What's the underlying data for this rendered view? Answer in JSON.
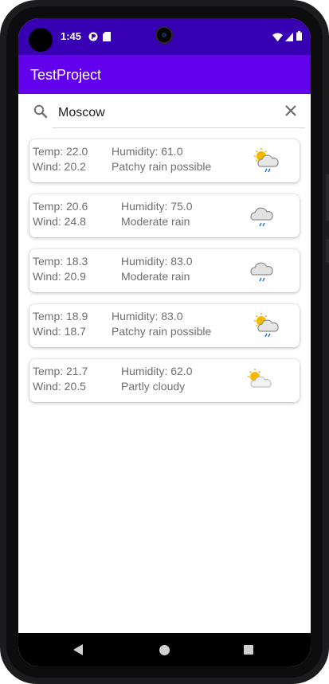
{
  "status_bar": {
    "time": "1:45",
    "icons": [
      "notification-icon",
      "sd-card-icon",
      "wifi-icon",
      "cellular-signal-icon",
      "battery-icon"
    ],
    "color": "#3700b3"
  },
  "app_bar": {
    "title": "TestProject",
    "color": "#6200ee"
  },
  "search": {
    "value": "Moscow",
    "icon": "search-icon",
    "clear_icon": "close-icon"
  },
  "forecasts": [
    {
      "temp": "Temp: 22.0",
      "wind": "Wind: 20.2",
      "humidity": "Humidity: 61.0",
      "condition": "Patchy rain possible",
      "icon": "sun-cloud-rain-icon"
    },
    {
      "temp": "Temp: 20.6",
      "wind": "Wind: 24.8",
      "humidity": "Humidity: 75.0",
      "condition": "Moderate rain",
      "icon": "cloud-rain-icon"
    },
    {
      "temp": "Temp: 18.3",
      "wind": "Wind: 20.9",
      "humidity": "Humidity: 83.0",
      "condition": "Moderate rain",
      "icon": "cloud-rain-icon"
    },
    {
      "temp": "Temp: 18.9",
      "wind": "Wind: 18.7",
      "humidity": "Humidity: 83.0",
      "condition": "Patchy rain possible",
      "icon": "sun-cloud-rain-icon"
    },
    {
      "temp": "Temp: 21.7",
      "wind": "Wind: 20.5",
      "humidity": "Humidity: 62.0",
      "condition": "Partly cloudy",
      "icon": "partly-cloudy-icon"
    }
  ],
  "nav_bar": {
    "buttons": [
      "back-icon",
      "home-icon",
      "recents-icon"
    ]
  }
}
